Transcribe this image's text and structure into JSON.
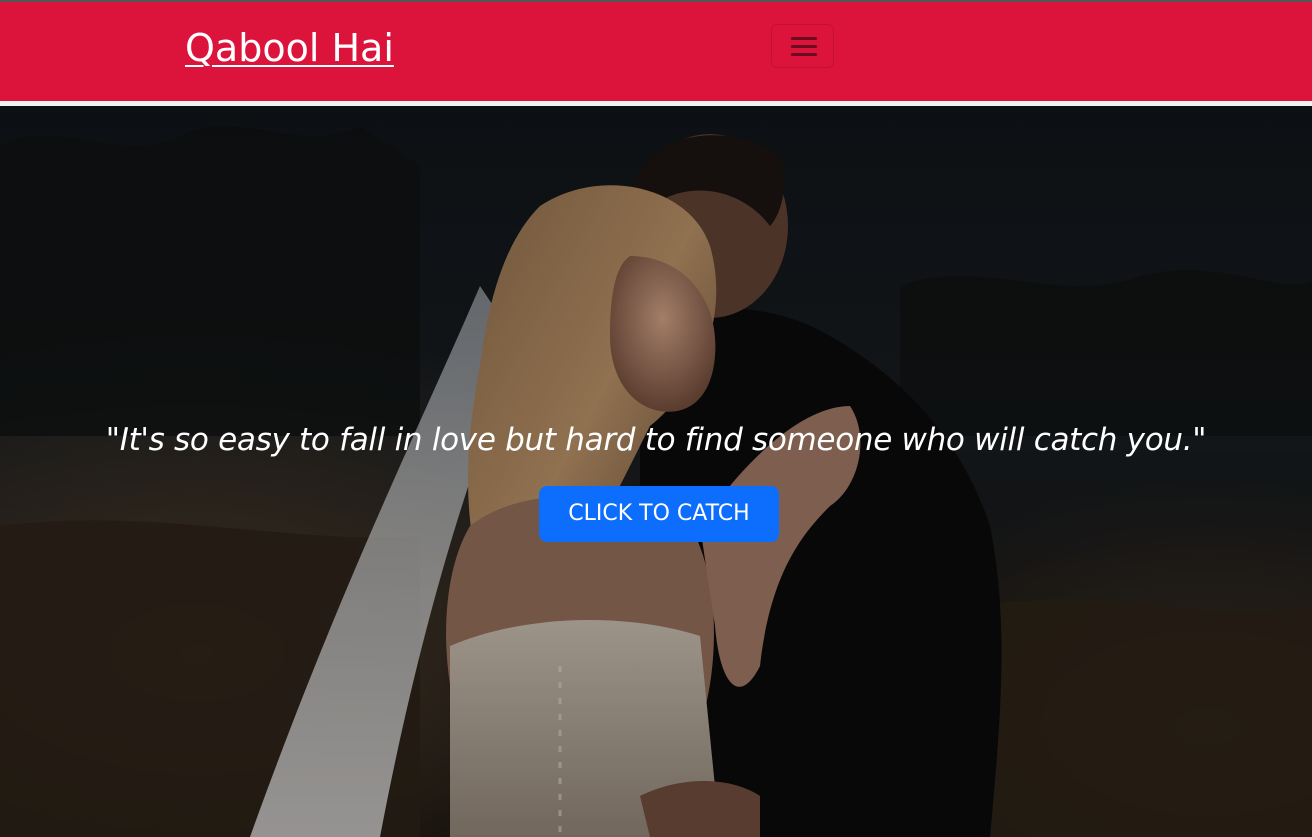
{
  "navbar": {
    "brand": "Qabool Hai",
    "toggler_icon": "hamburger-menu-icon",
    "background": "#dc143c"
  },
  "hero": {
    "background_image": "couple-embracing-photo",
    "quote": "\"It's so easy to fall in love but hard to find someone who will catch you.\"",
    "cta_label": "CLICK TO CATCH",
    "cta_color": "#0d6efd"
  }
}
